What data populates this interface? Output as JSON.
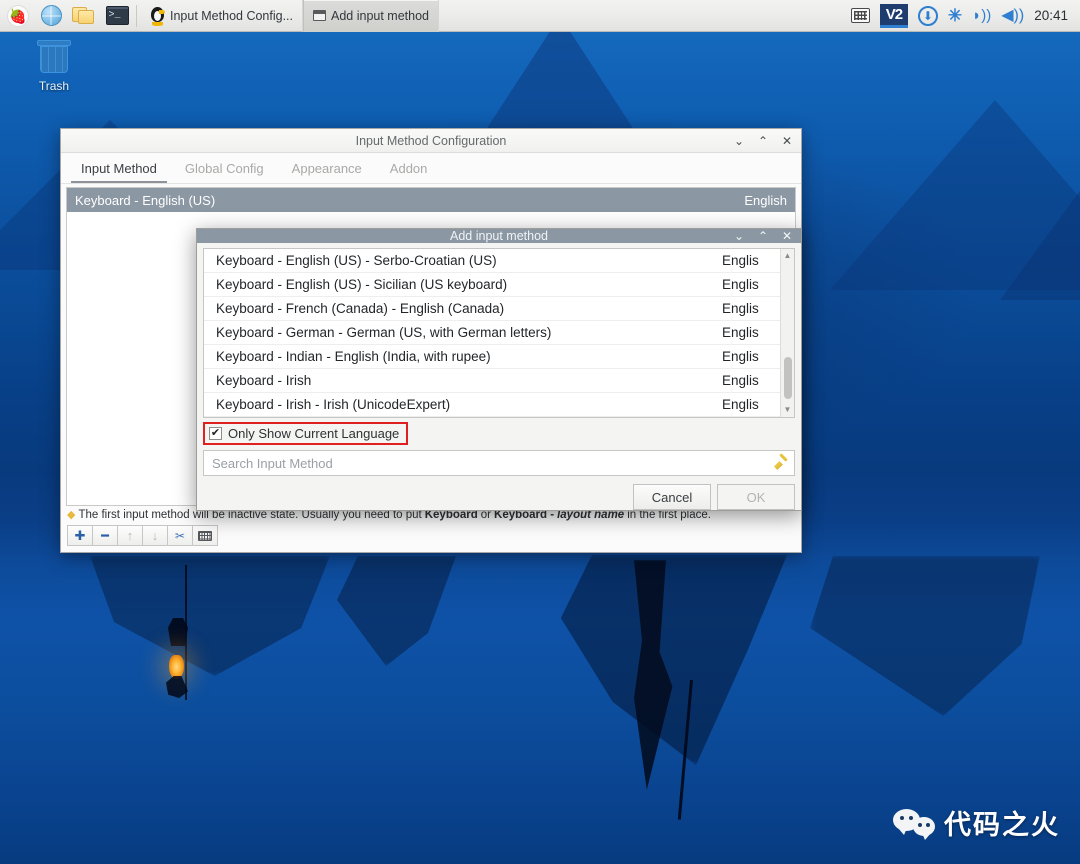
{
  "taskbar": {
    "launchers": [
      {
        "name": "raspberry-menu",
        "glyph": "🍓"
      },
      {
        "name": "web-browser",
        "glyph": ""
      },
      {
        "name": "file-manager",
        "glyph": ""
      },
      {
        "name": "terminal",
        "glyph": ">_"
      }
    ],
    "windows": [
      {
        "label": "Input Method Config...",
        "icon": "penguin-icon",
        "active": false
      },
      {
        "label": "Add input method",
        "icon": "window-icon",
        "active": true
      }
    ],
    "tray": {
      "keyboard_icon": "keyboard-icon",
      "vnc_label": "V2",
      "update_icon": "⬇",
      "bluetooth_icon": "✳",
      "wifi_icon": "📶",
      "volume_icon": "🔊",
      "clock": "20:41"
    }
  },
  "desktop": {
    "trash": {
      "label": "Trash",
      "icon": "trash-icon"
    },
    "watermark": {
      "text": "代码之火",
      "logo": "wechat-logo"
    }
  },
  "main_window": {
    "title": "Input Method Configuration",
    "controls": {
      "minimize": "⌄",
      "maximize": "⌃",
      "close": "✕"
    },
    "tabs": [
      {
        "label": "Input Method",
        "active": true
      },
      {
        "label": "Global Config",
        "active": false
      },
      {
        "label": "Appearance",
        "active": false
      },
      {
        "label": "Addon",
        "active": false
      }
    ],
    "input_methods": [
      {
        "name": "Keyboard - English (US)",
        "language": "English",
        "selected": true
      }
    ],
    "hint": {
      "diamond": "◆",
      "part1": "The first input method will be inactive state. Usually you need to put ",
      "bold1": "Keyboard",
      "mid": " or ",
      "bold2": "Keyboard - ",
      "italic2": "layout name",
      "part2": " in the first place."
    },
    "toolbar": [
      {
        "name": "add-button",
        "glyph": "✚",
        "enabled": true
      },
      {
        "name": "remove-button",
        "glyph": "━",
        "enabled": true
      },
      {
        "name": "move-up-button",
        "glyph": "↑",
        "enabled": false
      },
      {
        "name": "move-down-button",
        "glyph": "↓",
        "enabled": false
      },
      {
        "name": "configure-button",
        "glyph": "✂",
        "enabled": true
      },
      {
        "name": "keyboard-layout-button",
        "glyph": "",
        "enabled": true
      }
    ]
  },
  "add_dialog": {
    "title": "Add input method",
    "controls": {
      "minimize": "⌄",
      "maximize": "⌃",
      "close": "✕"
    },
    "rows": [
      {
        "name": "Keyboard - English (US) - Serbo-Croatian (US)",
        "language": "Englis"
      },
      {
        "name": "Keyboard - English (US) - Sicilian (US keyboard)",
        "language": "Englis"
      },
      {
        "name": "Keyboard - French (Canada) - English (Canada)",
        "language": "Englis"
      },
      {
        "name": "Keyboard - German - German (US, with German letters)",
        "language": "Englis"
      },
      {
        "name": "Keyboard - Indian - English (India, with rupee)",
        "language": "Englis"
      },
      {
        "name": "Keyboard - Irish",
        "language": "Englis"
      },
      {
        "name": "Keyboard - Irish - Irish (UnicodeExpert)",
        "language": "Englis"
      }
    ],
    "scrollbar": {
      "up": "▲",
      "down": "▼"
    },
    "checkbox": {
      "label": "Only Show Current Language",
      "checked": true,
      "check_glyph": "✔",
      "highlight_color": "#e02020"
    },
    "search": {
      "placeholder": "Search Input Method",
      "value": "",
      "clear_icon": "broom-icon"
    },
    "buttons": [
      {
        "label": "Cancel",
        "enabled": true
      },
      {
        "label": "OK",
        "enabled": false
      }
    ]
  }
}
